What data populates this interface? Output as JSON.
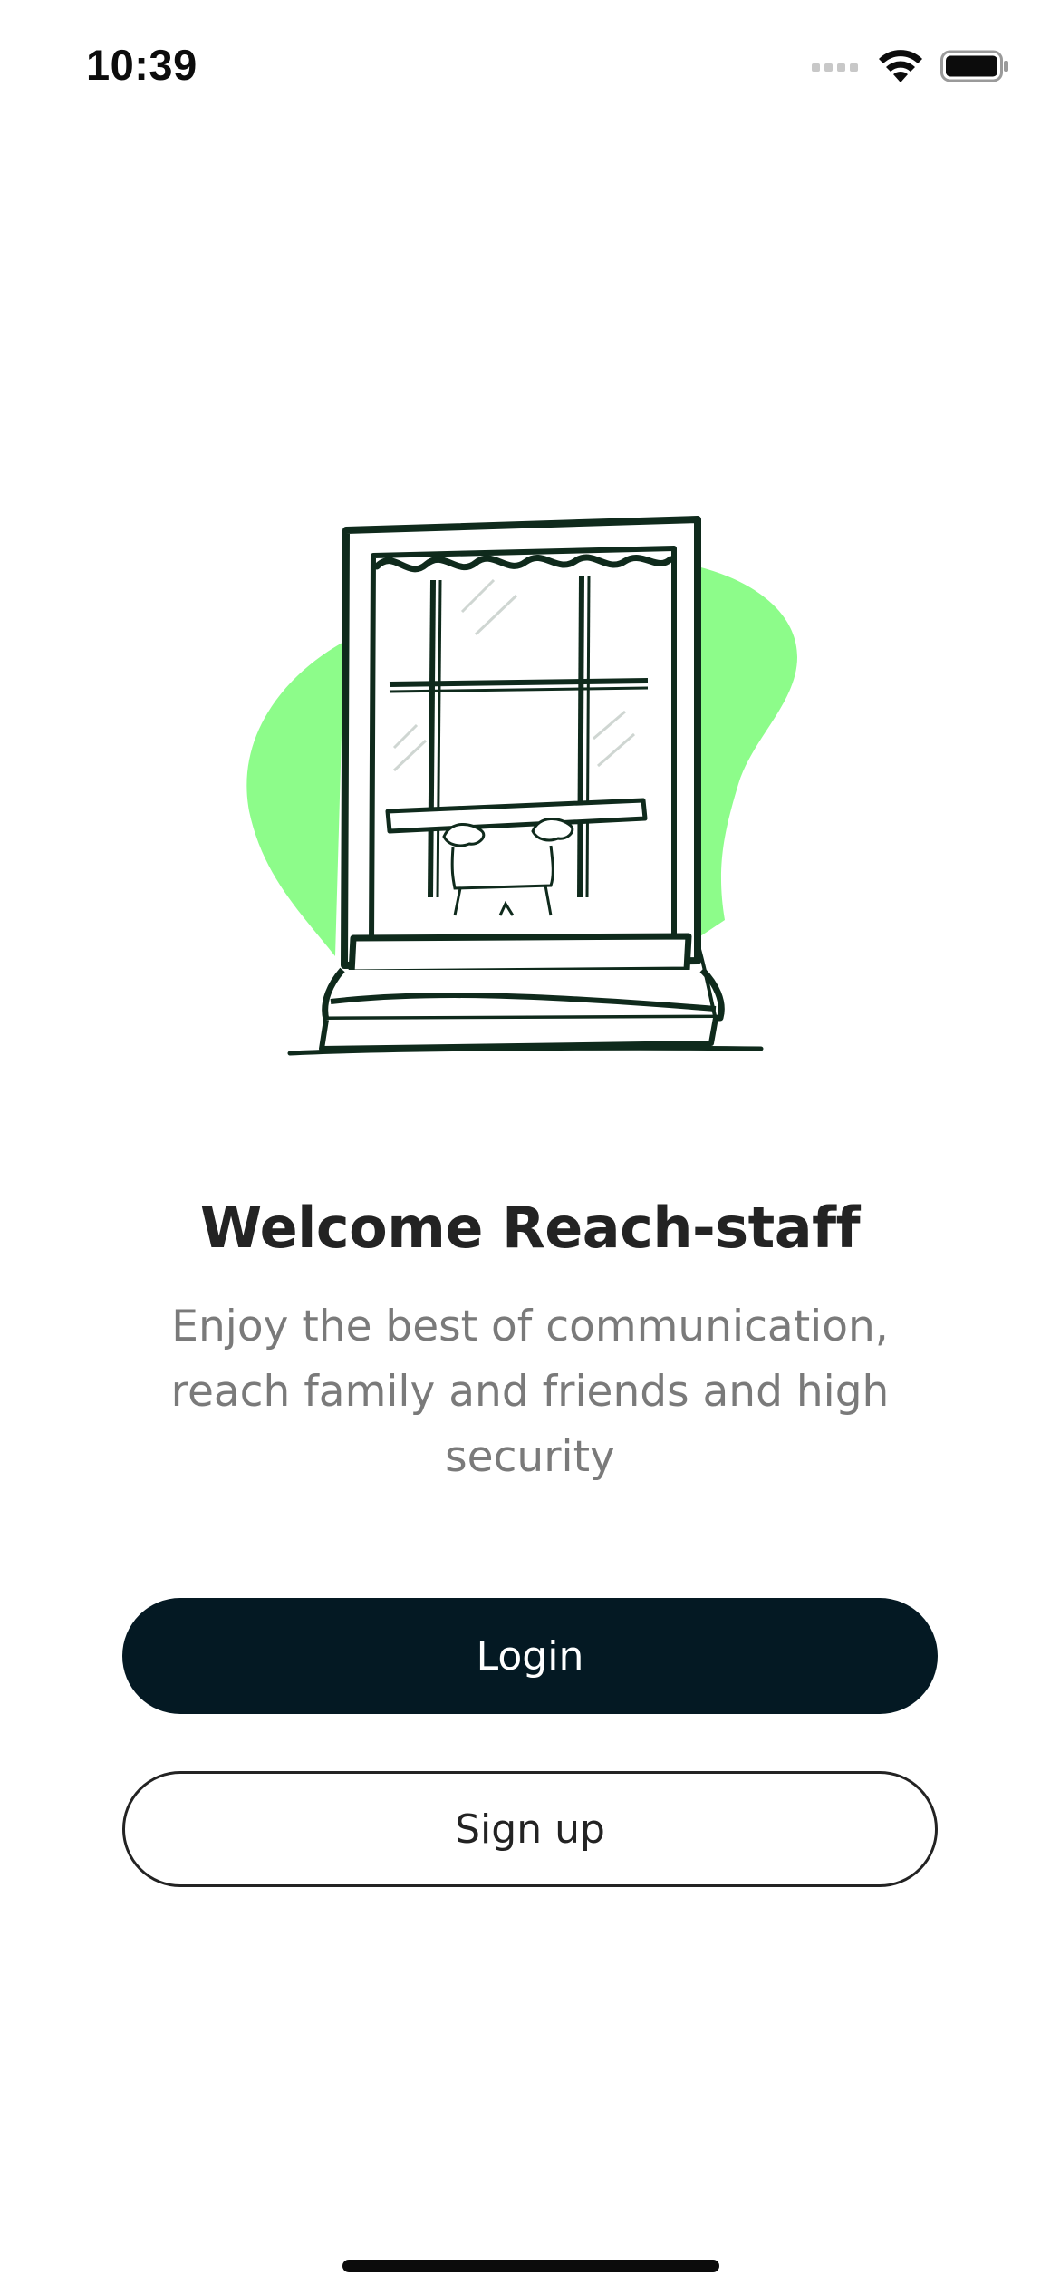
{
  "status_bar": {
    "time": "10:39",
    "icons": [
      "signal-icon",
      "wifi-icon",
      "battery-icon"
    ]
  },
  "hero": {
    "illustration": "window-with-person-illustration",
    "accent_color": "#8dfc8a",
    "ink_color": "#0f2a1c"
  },
  "welcome": {
    "title": "Welcome Reach-staff",
    "subtitle": "Enjoy the best of communication, reach family and friends and high security"
  },
  "actions": {
    "login_label": "Login",
    "signup_label": "Sign up",
    "primary_color": "#041923"
  }
}
